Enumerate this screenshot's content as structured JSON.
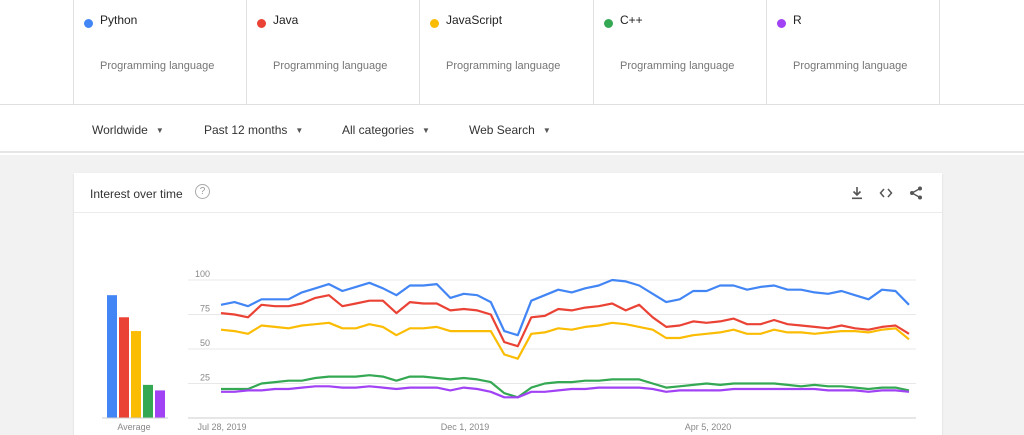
{
  "terms": [
    {
      "name": "Python",
      "type": "Programming language",
      "color": "#4285f4"
    },
    {
      "name": "Java",
      "type": "Programming language",
      "color": "#ea4335"
    },
    {
      "name": "JavaScript",
      "type": "Programming language",
      "color": "#fbbc04"
    },
    {
      "name": "C++",
      "type": "Programming language",
      "color": "#34a853"
    },
    {
      "name": "R",
      "type": "Programming language",
      "color": "#a142f4"
    }
  ],
  "filters": {
    "region": "Worldwide",
    "time": "Past 12 months",
    "category": "All categories",
    "search_type": "Web Search"
  },
  "card": {
    "title": "Interest over time",
    "help_icon": "?",
    "icons": [
      "download-icon",
      "embed-icon",
      "share-icon"
    ]
  },
  "chart_data": [
    {
      "type": "bar",
      "categories": [
        "Python",
        "Java",
        "JavaScript",
        "C++",
        "R"
      ],
      "values": [
        89,
        73,
        63,
        24,
        20
      ],
      "xlabel": "Average",
      "colors": [
        "#4285f4",
        "#ea4335",
        "#fbbc04",
        "#34a853",
        "#a142f4"
      ]
    },
    {
      "type": "line",
      "x_labels": [
        "Jul 28, 2019",
        "Dec 1, 2019",
        "Apr 5, 2020"
      ],
      "ylim": [
        0,
        100
      ],
      "yticks": [
        25,
        50,
        75,
        100
      ],
      "grid": true,
      "series": [
        {
          "name": "Python",
          "color": "#4285f4",
          "values": [
            82,
            84,
            81,
            86,
            86,
            86,
            91,
            94,
            97,
            92,
            95,
            98,
            94,
            89,
            96,
            96,
            97,
            87,
            90,
            89,
            84,
            63,
            60,
            85,
            89,
            93,
            91,
            94,
            96,
            100,
            99,
            96,
            90,
            84,
            86,
            92,
            92,
            96,
            96,
            93,
            95,
            96,
            93,
            93,
            91,
            90,
            92,
            89,
            86,
            93,
            92,
            82
          ]
        },
        {
          "name": "Java",
          "color": "#ea4335",
          "values": [
            76,
            75,
            73,
            82,
            81,
            81,
            83,
            87,
            89,
            81,
            83,
            85,
            85,
            76,
            84,
            83,
            83,
            78,
            79,
            78,
            75,
            55,
            52,
            73,
            74,
            79,
            78,
            80,
            81,
            83,
            78,
            82,
            73,
            66,
            67,
            70,
            69,
            70,
            72,
            68,
            68,
            71,
            68,
            67,
            66,
            65,
            67,
            65,
            64,
            66,
            67,
            61
          ]
        },
        {
          "name": "JavaScript",
          "color": "#fbbc04",
          "values": [
            64,
            63,
            61,
            67,
            66,
            65,
            67,
            68,
            69,
            65,
            65,
            68,
            66,
            60,
            65,
            65,
            66,
            63,
            63,
            63,
            63,
            46,
            43,
            61,
            62,
            65,
            64,
            66,
            67,
            69,
            68,
            66,
            64,
            58,
            58,
            60,
            61,
            62,
            64,
            61,
            61,
            64,
            62,
            62,
            61,
            62,
            63,
            63,
            62,
            64,
            65,
            57
          ]
        },
        {
          "name": "C++",
          "color": "#34a853",
          "values": [
            21,
            21,
            21,
            25,
            26,
            27,
            27,
            29,
            30,
            30,
            30,
            31,
            30,
            27,
            30,
            30,
            29,
            28,
            29,
            28,
            26,
            18,
            15,
            22,
            25,
            26,
            26,
            27,
            27,
            28,
            28,
            28,
            25,
            22,
            23,
            24,
            25,
            24,
            25,
            25,
            25,
            25,
            24,
            23,
            24,
            23,
            23,
            22,
            21,
            22,
            22,
            20
          ]
        },
        {
          "name": "R",
          "color": "#a142f4",
          "values": [
            19,
            19,
            20,
            20,
            21,
            21,
            22,
            23,
            23,
            22,
            22,
            23,
            22,
            21,
            22,
            22,
            22,
            20,
            22,
            21,
            19,
            15,
            15,
            19,
            19,
            20,
            21,
            21,
            22,
            22,
            22,
            22,
            21,
            19,
            20,
            20,
            20,
            20,
            21,
            21,
            21,
            21,
            21,
            21,
            21,
            20,
            20,
            20,
            19,
            20,
            20,
            19
          ]
        }
      ]
    }
  ]
}
